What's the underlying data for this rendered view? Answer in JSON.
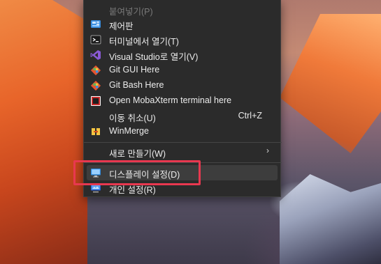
{
  "context_menu": {
    "items": [
      {
        "label": "붙여넣기(P)",
        "icon": "paste-icon",
        "disabled": true
      },
      {
        "label": "제어판",
        "icon": "control-panel-icon"
      },
      {
        "label": "터미널에서 열기(T)",
        "icon": "terminal-icon"
      },
      {
        "label": "Visual Studio로 열기(V)",
        "icon": "visual-studio-icon"
      },
      {
        "label": "Git GUI Here",
        "icon": "git-gui-icon"
      },
      {
        "label": "Git Bash Here",
        "icon": "git-bash-icon"
      },
      {
        "label": "Open MobaXterm terminal here",
        "icon": "mobaxterm-icon"
      },
      {
        "label": "이동 취소(U)",
        "shortcut": "Ctrl+Z"
      },
      {
        "label": "WinMerge",
        "icon": "winmerge-icon"
      },
      {
        "label": "새로 만들기(W)",
        "submenu_arrow": "›"
      },
      {
        "label": "디스플레이 설정(D)",
        "icon": "display-settings-icon",
        "hovered": true
      },
      {
        "label": "개인 설정(R)",
        "icon": "personalize-icon"
      }
    ]
  },
  "colors": {
    "menu_background": "#2b2b2b",
    "hover_background": "#3d3d3d",
    "highlight_box": "#e8384f",
    "text": "#ececec"
  }
}
